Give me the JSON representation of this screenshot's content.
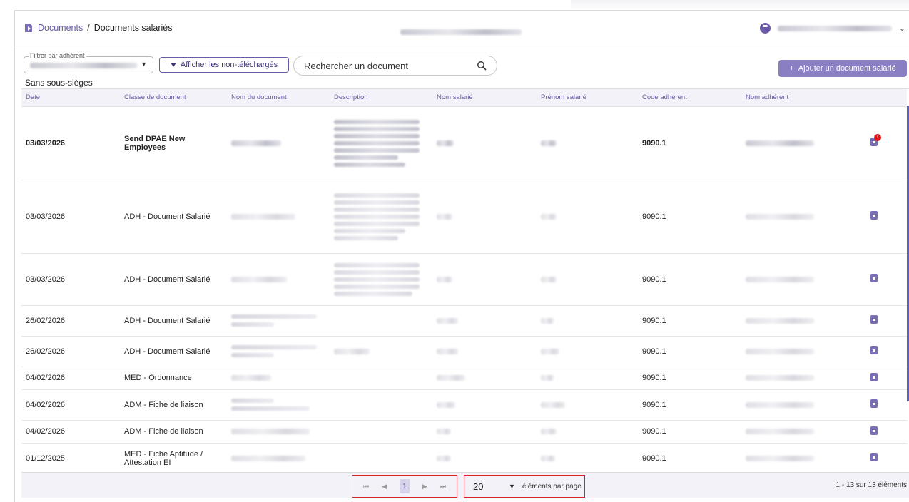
{
  "breadcrumb": {
    "parent": "Documents",
    "separator": "/",
    "current": "Documents salariés"
  },
  "header": {
    "icon": "document-icon"
  },
  "user": {
    "icon": "user-circle-icon",
    "chevron": "⌄"
  },
  "filters": {
    "adherent_label": "Filtrer par adhérent",
    "show_not_downloaded_label": "Afficher les non-téléchargés",
    "search_placeholder": "Rechercher un document",
    "add_button_label": "Ajouter un document salarié",
    "add_button_prefix": "+"
  },
  "section_label": "Sans sous-sièges",
  "table": {
    "columns": [
      "Date",
      "Classe de document",
      "Nom du document",
      "Description",
      "Nom salarié",
      "Prénom salarié",
      "Code adhérent",
      "Nom adhérent",
      ""
    ],
    "rows": [
      {
        "date": "03/03/2026",
        "classe": "Send DPAE New Employees",
        "code": "9090.1",
        "bold": true,
        "badge": "!"
      },
      {
        "date": "03/03/2026",
        "classe": "ADH - Document Salarié",
        "code": "9090.1"
      },
      {
        "date": "03/03/2026",
        "classe": "ADH - Document Salarié",
        "code": "9090.1"
      },
      {
        "date": "26/02/2026",
        "classe": "ADH - Document Salarié",
        "code": "9090.1"
      },
      {
        "date": "26/02/2026",
        "classe": "ADH - Document Salarié",
        "code": "9090.1"
      },
      {
        "date": "04/02/2026",
        "classe": "MED - Ordonnance",
        "code": "9090.1"
      },
      {
        "date": "04/02/2026",
        "classe": "ADM - Fiche de liaison",
        "code": "9090.1"
      },
      {
        "date": "04/02/2026",
        "classe": "ADM - Fiche de liaison",
        "code": "9090.1"
      },
      {
        "date": "01/12/2025",
        "classe_line1": "MED - Fiche Aptitude /",
        "classe_line2": "Attestation EI",
        "code": "9090.1"
      }
    ]
  },
  "pagination": {
    "first": "⏮",
    "prev": "◀",
    "page": "1",
    "next": "▶",
    "last": "⏭",
    "per_page_value": "20",
    "per_page_label": "éléments par page",
    "range_text": "1 - 13 sur 13 éléments"
  },
  "colors": {
    "accent": "#6a5aa8",
    "button": "#8a7fc2",
    "highlight": "#d8232a",
    "badge": "#e0161c"
  }
}
